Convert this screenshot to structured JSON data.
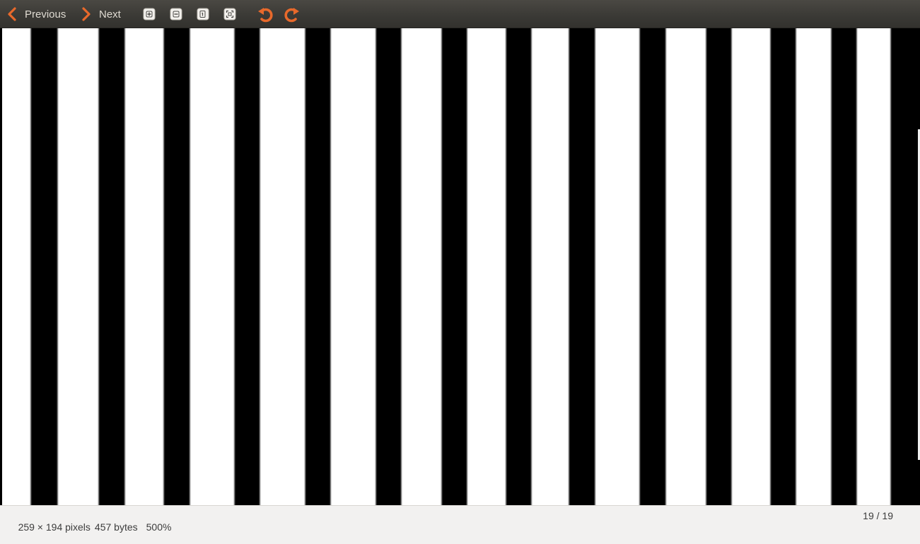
{
  "toolbar": {
    "previous_label": "Previous",
    "next_label": "Next",
    "icons": [
      "zoom-in-icon",
      "zoom-out-icon",
      "normal-size-icon",
      "best-fit-icon",
      "rotate-left-icon",
      "rotate-right-icon"
    ],
    "accent_color": "#e05a1e"
  },
  "image": {
    "description_colors": [
      "#000000",
      "#ffffff"
    ]
  },
  "status": {
    "dimensions": "259 × 194 pixels",
    "size": "457 bytes",
    "zoom": "500%",
    "position": "19 / 19"
  }
}
